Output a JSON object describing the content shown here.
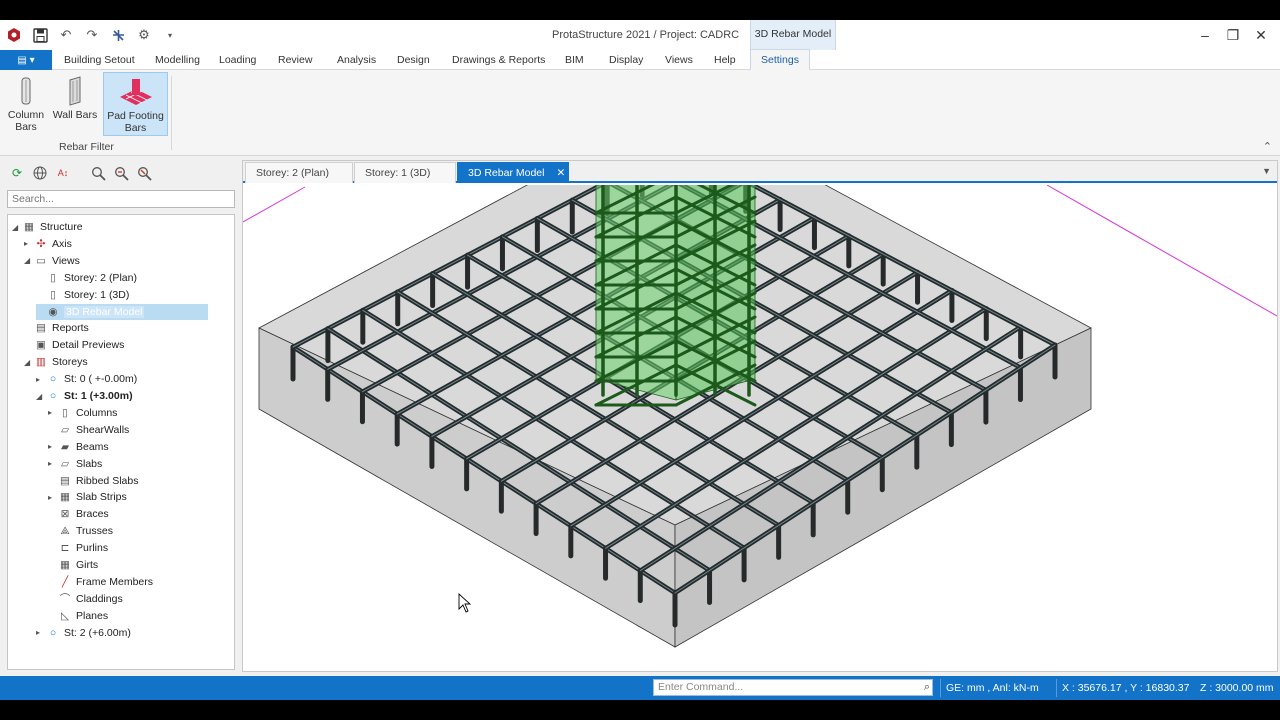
{
  "app": {
    "title": "ProtaStructure 2021 / Project: CADRC",
    "context_tab": "3D Rebar Model"
  },
  "menu": {
    "file_glyph": "▤ ▾",
    "items": [
      "Building Setout",
      "Modelling",
      "Loading",
      "Review",
      "Analysis",
      "Design",
      "Drawings & Reports",
      "BIM",
      "Display",
      "Views",
      "Help",
      "Settings"
    ],
    "active": "Settings"
  },
  "ribbon": {
    "buttons": [
      {
        "label": "Column Bars",
        "icon": "column-bars-icon"
      },
      {
        "label": "Wall Bars",
        "icon": "wall-bars-icon"
      },
      {
        "label": "Pad Footing Bars",
        "icon": "pad-footing-bars-icon",
        "selected": true
      }
    ],
    "group_label": "Rebar Filter"
  },
  "left_panel": {
    "search_placeholder": "Search...",
    "tree": [
      {
        "label": "Structure",
        "level": 0,
        "exp": "◢",
        "icon": "grid-icon"
      },
      {
        "label": "Axis",
        "level": 1,
        "exp": "▸",
        "icon": "axis-icon"
      },
      {
        "label": "Views",
        "level": 1,
        "exp": "◢",
        "icon": "views-icon"
      },
      {
        "label": "Storey: 2 (Plan)",
        "level": 2,
        "exp": "",
        "icon": "plan-view-icon"
      },
      {
        "label": "Storey: 1 (3D)",
        "level": 2,
        "exp": "",
        "icon": "3d-view-icon"
      },
      {
        "label": "3D Rebar Model",
        "level": 2,
        "exp": "",
        "icon": "eye-icon",
        "highlight": true
      },
      {
        "label": "Reports",
        "level": 1,
        "exp": "",
        "icon": "printer-icon"
      },
      {
        "label": "Detail Previews",
        "level": 1,
        "exp": "",
        "icon": "detail-preview-icon"
      },
      {
        "label": "Storeys",
        "level": 1,
        "exp": "◢",
        "icon": "storeys-icon"
      },
      {
        "label": "St: 0 ( +-0.00m)",
        "level": 2,
        "exp": "▸",
        "icon": "storey-dot-icon"
      },
      {
        "label": "St: 1 (+3.00m)",
        "level": 2,
        "exp": "◢",
        "icon": "storey-dot-icon",
        "bold": true
      },
      {
        "label": "Columns",
        "level": 3,
        "exp": "▸",
        "icon": "columns-icon"
      },
      {
        "label": "ShearWalls",
        "level": 3,
        "exp": "",
        "icon": "shearwalls-icon"
      },
      {
        "label": "Beams",
        "level": 3,
        "exp": "▸",
        "icon": "beams-icon"
      },
      {
        "label": "Slabs",
        "level": 3,
        "exp": "▸",
        "icon": "slabs-icon"
      },
      {
        "label": "Ribbed Slabs",
        "level": 3,
        "exp": "",
        "icon": "ribbed-slabs-icon"
      },
      {
        "label": "Slab Strips",
        "level": 3,
        "exp": "▸",
        "icon": "slab-strips-icon"
      },
      {
        "label": "Braces",
        "level": 3,
        "exp": "",
        "icon": "braces-icon"
      },
      {
        "label": "Trusses",
        "level": 3,
        "exp": "",
        "icon": "trusses-icon"
      },
      {
        "label": "Purlins",
        "level": 3,
        "exp": "",
        "icon": "purlins-icon"
      },
      {
        "label": "Girts",
        "level": 3,
        "exp": "",
        "icon": "girts-icon"
      },
      {
        "label": "Frame Members",
        "level": 3,
        "exp": "",
        "icon": "frame-members-icon"
      },
      {
        "label": "Claddings",
        "level": 3,
        "exp": "",
        "icon": "claddings-icon"
      },
      {
        "label": "Planes",
        "level": 3,
        "exp": "",
        "icon": "planes-icon"
      },
      {
        "label": "St: 2 (+6.00m)",
        "level": 2,
        "exp": "▸",
        "icon": "storey-dot-icon"
      }
    ]
  },
  "doc_tabs": [
    {
      "label": "Storey: 2 (Plan)",
      "active": false
    },
    {
      "label": "Storey: 1 (3D)",
      "active": false
    },
    {
      "label": "3D Rebar Model",
      "active": true
    }
  ],
  "doc_tab_close": "✕",
  "status": {
    "command_placeholder": "Enter Command...",
    "units": "GE: mm , Anl: kN-m",
    "xy": "X : 35676.17 , Y : 16830.37",
    "z": "Z : 3000.00 mm"
  },
  "colors": {
    "accent": "#1273c9",
    "column_green": "#6bd46b",
    "rebar": "#262a2b"
  }
}
